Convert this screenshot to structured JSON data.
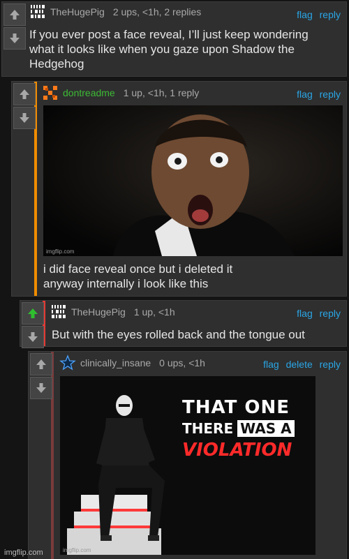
{
  "comments": [
    {
      "username": "TheHugePig",
      "meta": "2 ups, <1h, 2 replies",
      "actions": [
        "flag",
        "reply"
      ],
      "text_lines": [
        "If you ever post a face reveal, I’ll just keep wondering",
        "what it looks like when you gaze upon Shadow the",
        "Hedgehog"
      ]
    },
    {
      "username": "dontreadme",
      "meta": "1 up, <1h, 1 reply",
      "actions": [
        "flag",
        "reply"
      ],
      "image_watermark": "imgflip.com",
      "text_lines": [
        "i did face reveal once but i deleted it",
        "anyway internally i look like this"
      ]
    },
    {
      "username": "TheHugePig",
      "meta": "1 up, <1h",
      "actions": [
        "flag",
        "reply"
      ],
      "upvoted": true,
      "text_lines": [
        "But with the eyes rolled back and the tongue out"
      ]
    },
    {
      "username": "clinically_insane",
      "meta": "0 ups, <1h",
      "actions": [
        "flag",
        "delete",
        "reply"
      ],
      "image_watermark": "imgflip.com",
      "meme_text": [
        "THAT ONE",
        "THERE",
        "WAS A",
        "VIOLATION"
      ]
    }
  ],
  "footer_watermark": "imgflip.com",
  "colors": {
    "link": "#2aa6e6",
    "username_green": "#3dba35",
    "bar_orange": "#f08c00",
    "bar_red": "#e53935",
    "bar_dark_red": "#7a3b3b",
    "upvote_green": "#2fbf2f"
  }
}
